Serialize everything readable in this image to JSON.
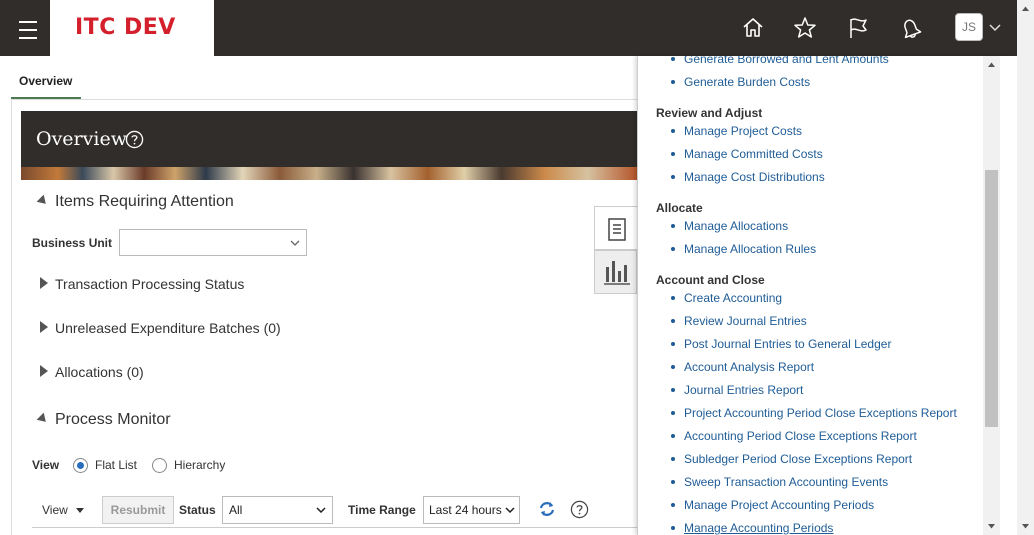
{
  "header": {
    "logo": "ITC DEV",
    "user_initials": "JS",
    "icons": [
      "home-icon",
      "star-icon",
      "flag-icon",
      "bell-icon"
    ]
  },
  "tabs": [
    {
      "label": "Overview"
    }
  ],
  "overview": {
    "title": "Overview",
    "items_requiring_attention": "Items Requiring Attention",
    "business_unit_label": "Business Unit",
    "business_unit_value": "",
    "rows": [
      {
        "label": "Transaction Processing Status"
      },
      {
        "label": "Unreleased Expenditure Batches (0)"
      },
      {
        "label": "Allocations (0)"
      }
    ],
    "process_monitor": "Process Monitor",
    "view_label": "View",
    "radio_flat": "Flat List",
    "radio_hierarchy": "Hierarchy",
    "toolbar": {
      "view_menu": "View",
      "resubmit": "Resubmit",
      "status_label": "Status",
      "status_value": "All",
      "time_range_label": "Time Range",
      "time_range_value": "Last 24 hours"
    }
  },
  "tasks": {
    "pre_items": [
      {
        "label": "Generate Borrowed and Lent Amounts"
      },
      {
        "label": "Generate Burden Costs"
      }
    ],
    "groups": [
      {
        "title": "Review and Adjust",
        "items": [
          {
            "label": "Manage Project Costs"
          },
          {
            "label": "Manage Committed Costs"
          },
          {
            "label": "Manage Cost Distributions"
          }
        ]
      },
      {
        "title": "Allocate",
        "items": [
          {
            "label": "Manage Allocations"
          },
          {
            "label": "Manage Allocation Rules"
          }
        ]
      },
      {
        "title": "Account and Close",
        "items": [
          {
            "label": "Create Accounting"
          },
          {
            "label": "Review Journal Entries"
          },
          {
            "label": "Post Journal Entries to General Ledger"
          },
          {
            "label": "Account Analysis Report"
          },
          {
            "label": "Journal Entries Report"
          },
          {
            "label": "Project Accounting Period Close Exceptions Report"
          },
          {
            "label": "Accounting Period Close Exceptions Report"
          },
          {
            "label": "Subledger Period Close Exceptions Report"
          },
          {
            "label": "Sweep Transaction Accounting Events"
          },
          {
            "label": "Manage Project Accounting Periods"
          },
          {
            "label": "Manage Accounting Periods"
          }
        ]
      }
    ]
  },
  "colors": {
    "header_bg": "#312d2a",
    "logo": "#d4202c",
    "link": "#1f5c96",
    "tab_underline": "#4e7a52"
  }
}
